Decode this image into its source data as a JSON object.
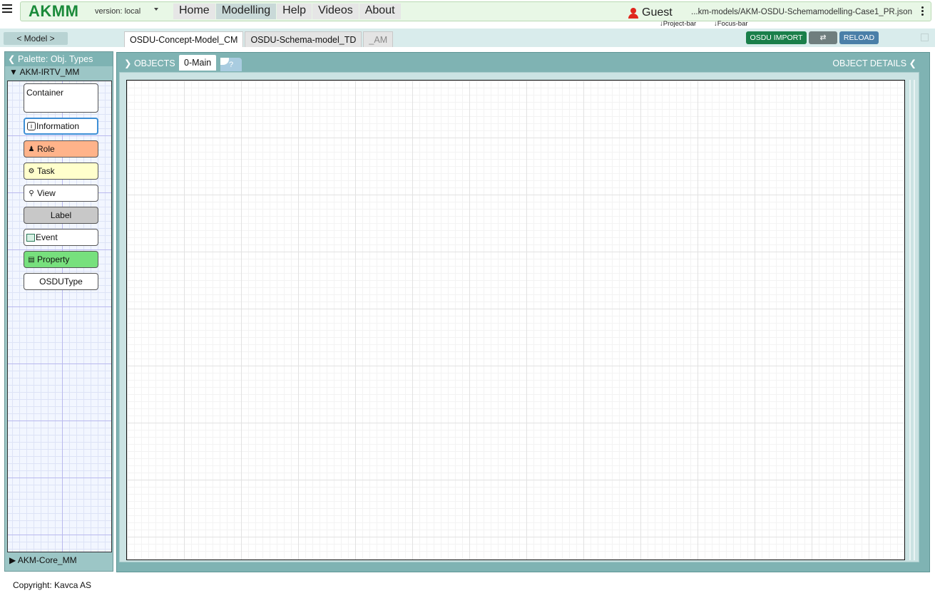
{
  "navbar": {
    "logo": "AKMM",
    "version": "version: local",
    "tabs": [
      "Home",
      "Modelling",
      "Help",
      "Videos",
      "About"
    ],
    "active_tab": "Modelling",
    "user": "Guest",
    "file_path": "...km-models/AKM-OSDU-Schemamodelling-Case1_PR.json",
    "hint_project": "↓Project-bar",
    "hint_focus": "↓Focus-bar"
  },
  "toolbar": {
    "model_button": "< Model >",
    "model_tabs": [
      "OSDU-Concept-Model_CM",
      "OSDU-Schema-model_TD",
      "_AM"
    ],
    "import_label": "OSDU IMPORT",
    "swap_label": "⇄",
    "reload_label": "RELOAD"
  },
  "palette": {
    "title": "Palette: Obj. Types",
    "group_top": "AKM-IRTV_MM",
    "group_bottom": "AKM-Core_MM",
    "items": [
      "Container",
      "Information",
      "Role",
      "Task",
      "View",
      "Label",
      "Event",
      "Property",
      "OSDUType"
    ]
  },
  "canvas": {
    "objects_label": "OBJECTS",
    "tab_main": "0-Main",
    "tab_help": "?",
    "details_label": "OBJECT DETAILS"
  },
  "colors": {
    "brand": "#1a8a3a",
    "role": "#ffb38a",
    "task": "#ffffcc",
    "label": "#c8c8c8",
    "property": "#77e07d",
    "import_btn": "#1a7f4a",
    "reload_btn": "#4a7fa8"
  },
  "footer": {
    "copyright": "Copyright: Kavca AS"
  }
}
